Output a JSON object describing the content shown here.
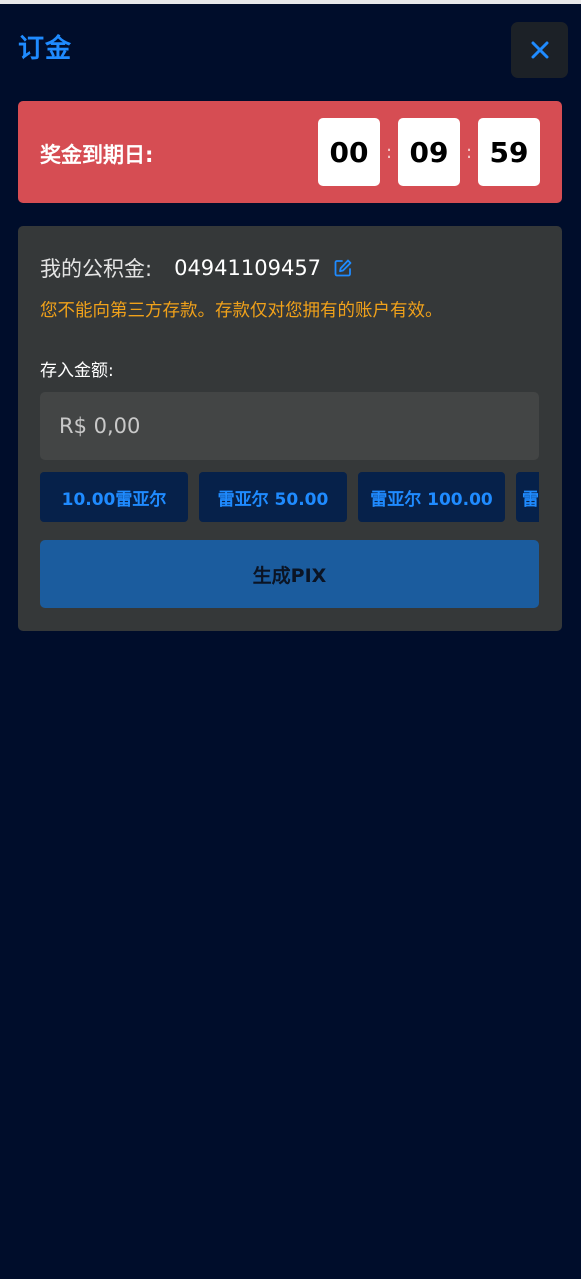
{
  "header": {
    "title": "订金",
    "close_icon": "close-icon"
  },
  "timer": {
    "label": "奖金到期日:",
    "hours": "00",
    "minutes": "09",
    "seconds": "59",
    "separator": ":"
  },
  "deposit": {
    "account_label": "我的公积金:",
    "account_number": "04941109457",
    "edit_icon": "edit-icon",
    "warning": "您不能向第三方存款。存款仅对您拥有的账户有效。",
    "amount_label": "存入金额:",
    "amount_placeholder": "R$ 0,00",
    "quick_amounts": [
      "10.00雷亚尔",
      "雷亚尔 50.00",
      "雷亚尔 100.00",
      "雷"
    ],
    "generate_label": "生成PIX"
  },
  "colors": {
    "background": "#000d2b",
    "accent": "#1f8bff",
    "timer_bg": "#d64d53",
    "card_bg": "#353839",
    "warning": "#f0a11a",
    "button_bg": "#1b5c9e"
  }
}
